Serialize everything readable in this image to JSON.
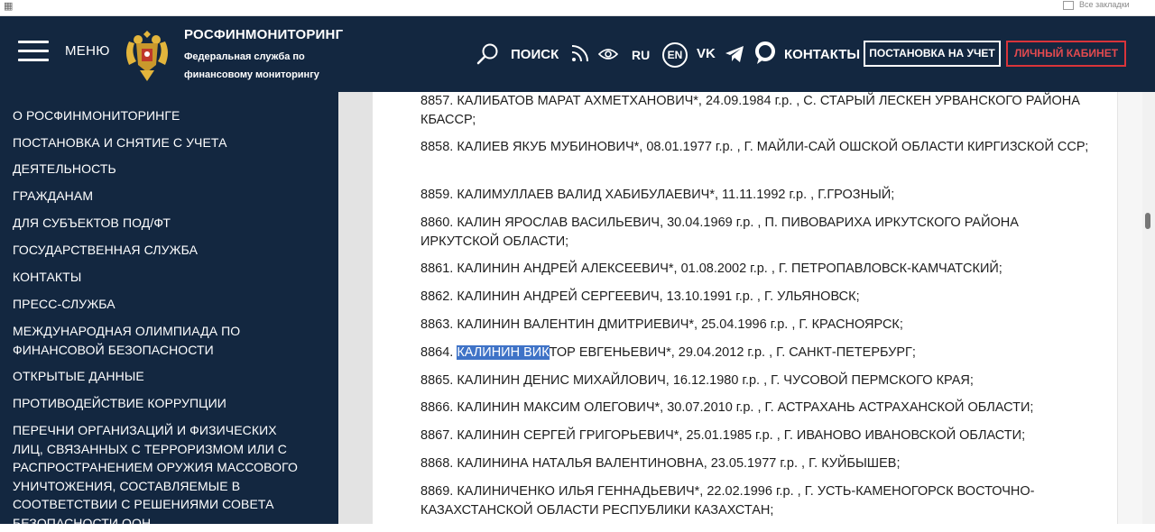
{
  "browser": {
    "apps_icon": "apps-grid-icon",
    "bookmarks_label": "Все закладки"
  },
  "header": {
    "menu_label": "МЕНЮ",
    "brand_title": "РОСФИНМОНИТОРИНГ",
    "brand_subtitle_line1": "Федеральная служба по",
    "brand_subtitle_line2": "финансовому мониторингу",
    "search_label": "ПОИСК",
    "lang_ru": "RU",
    "lang_en": "EN",
    "vk_label": "VK",
    "contacts_label": "КОНТАКТЫ",
    "register_button": "ПОСТАНОВКА НА УЧЕТ",
    "cabinet_button": "ЛИЧНЫЙ КАБИНЕТ",
    "colors": {
      "header_bg": "#132740",
      "cabinet_accent": "#d9343a"
    }
  },
  "sidebar": {
    "items": [
      {
        "label": "О РОСФИНМОНИТОРИНГЕ"
      },
      {
        "label": "ПОСТАНОВКА И СНЯТИЕ С УЧЕТА"
      },
      {
        "label": "ДЕЯТЕЛЬНОСТЬ"
      },
      {
        "label": "ГРАЖДАНАМ"
      },
      {
        "label": "ДЛЯ СУБЪЕКТОВ ПОД/ФТ"
      },
      {
        "label": "ГОСУДАРСТВЕННАЯ СЛУЖБА"
      },
      {
        "label": "КОНТАКТЫ"
      },
      {
        "label": "ПРЕСС-СЛУЖБА"
      },
      {
        "label": "МЕЖДУНАРОДНАЯ ОЛИМПИАДА ПО ФИНАНСОВОЙ БЕЗОПАСНОСТИ"
      },
      {
        "label": "ОТКРЫТЫЕ ДАННЫЕ"
      },
      {
        "label": "ПРОТИВОДЕЙСТВИЕ КОРРУПЦИИ"
      },
      {
        "label": "ПЕРЕЧНИ ОРГАНИЗАЦИЙ И ФИЗИЧЕСКИХ ЛИЦ, СВЯЗАННЫХ С ТЕРРОРИЗМОМ ИЛИ С РАСПРОСТРАНЕНИЕМ ОРУЖИЯ МАССОВОГО УНИЧТОЖЕНИЯ, СОСТАВЛЯЕМЫЕ В СООТВЕТСТВИИ С РЕШЕНИЯМИ СОВЕТА БЕЗОПАСНОСТИ ООН"
      }
    ]
  },
  "content": {
    "entries": [
      {
        "text": "8857. КАЛИБАТОВ МАРАТ АХМЕТХАНОВИЧ*, 24.09.1984 г.р. , С. СТАРЫЙ ЛЕСКЕН УРВАНСКОГО РАЙОНА КБАССР;"
      },
      {
        "text": "8858. КАЛИЕВ ЯКУБ МУБИНОВИЧ*, 08.01.1977 г.р. , Г. МАЙЛИ-САЙ ОШСКОЙ ОБЛАСТИ КИРГИЗСКОЙ ССР;"
      },
      {
        "text": "8859. КАЛИМУЛЛАЕВ ВАЛИД ХАБИБУЛАЕВИЧ*, 11.11.1992 г.р. , Г.ГРОЗНЫЙ;"
      },
      {
        "text": "8860. КАЛИН ЯРОСЛАВ ВАСИЛЬЕВИЧ, 30.04.1969 г.р. , П. ПИВОВАРИХА ИРКУТСКОГО РАЙОНА ИРКУТСКОЙ ОБЛАСТИ;"
      },
      {
        "text": "8861. КАЛИНИН АНДРЕЙ АЛЕКСЕЕВИЧ*, 01.08.2002 г.р. , Г. ПЕТРОПАВЛОВСК-КАМЧАТСКИЙ;"
      },
      {
        "text": "8862. КАЛИНИН АНДРЕЙ СЕРГЕЕВИЧ, 13.10.1991 г.р. , Г. УЛЬЯНОВСК;"
      },
      {
        "text": "8863. КАЛИНИН ВАЛЕНТИН ДМИТРИЕВИЧ*, 25.04.1996 г.р. , Г. КРАСНОЯРСК;"
      },
      {
        "text_prefix": "8864. ",
        "text_highlight": "КАЛИНИН ВИК",
        "text_rest": "ТОР ЕВГЕНЬЕВИЧ*, 29.04.2012 г.р. , Г. САНКТ-ПЕТЕРБУРГ;"
      },
      {
        "text": "8865. КАЛИНИН ДЕНИС МИХАЙЛОВИЧ, 16.12.1980 г.р. , Г. ЧУСОВОЙ ПЕРМСКОГО КРАЯ;"
      },
      {
        "text": "8866. КАЛИНИН МАКСИМ ОЛЕГОВИЧ*, 30.07.2010 г.р. , Г. АСТРАХАНЬ АСТРАХАНСКОЙ ОБЛАСТИ;"
      },
      {
        "text": "8867. КАЛИНИН СЕРГЕЙ ГРИГОРЬЕВИЧ*, 25.01.1985 г.р. , Г. ИВАНОВО ИВАНОВСКОЙ ОБЛАСТИ;"
      },
      {
        "text": "8868. КАЛИНИНА НАТАЛЬЯ ВАЛЕНТИНОВНА, 23.05.1977 г.р. , Г. КУЙБЫШЕВ;"
      },
      {
        "text": "8869. КАЛИНИЧЕНКО ИЛЬЯ ГЕННАДЬЕВИЧ*, 22.02.1996 г.р. , Г. УСТЬ-КАМЕНОГОРСК ВОСТОЧНО-КАЗАХСТАНСКОЙ ОБЛАСТИ РЕСПУБЛИКИ КАЗАХСТАН;"
      }
    ],
    "selection_color": "#3f73c7"
  }
}
